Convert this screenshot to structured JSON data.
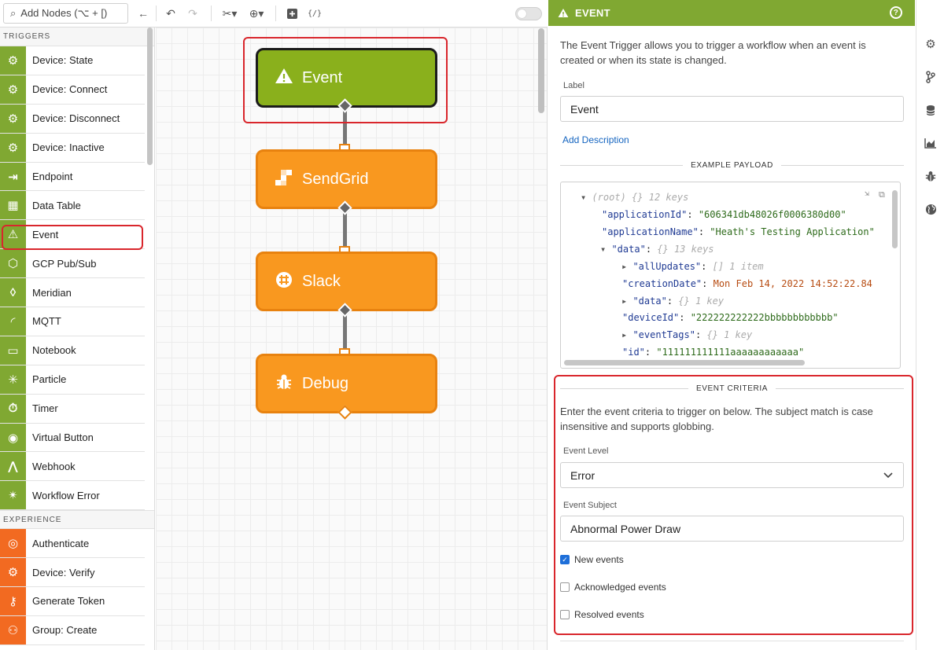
{
  "toolbar": {
    "search_placeholder": "Add Nodes (⌥ + [)",
    "icons": [
      "search-icon",
      "back-icon",
      "undo-icon",
      "redo-icon",
      "scissors-icon",
      "zoom-icon",
      "add-comment-icon",
      "variables-icon",
      "toggle-icon"
    ]
  },
  "sidebar": {
    "triggers_header": "TRIGGERS",
    "triggers": [
      {
        "label": "Device: State",
        "icon": "device-icon"
      },
      {
        "label": "Device: Connect",
        "icon": "device-icon"
      },
      {
        "label": "Device: Disconnect",
        "icon": "device-icon"
      },
      {
        "label": "Device: Inactive",
        "icon": "device-icon"
      },
      {
        "label": "Endpoint",
        "icon": "endpoint-icon"
      },
      {
        "label": "Data Table",
        "icon": "table-icon"
      },
      {
        "label": "Event",
        "icon": "warning-icon"
      },
      {
        "label": "GCP Pub/Sub",
        "icon": "gcp-icon"
      },
      {
        "label": "Meridian",
        "icon": "meridian-icon"
      },
      {
        "label": "MQTT",
        "icon": "mqtt-icon"
      },
      {
        "label": "Notebook",
        "icon": "notebook-icon"
      },
      {
        "label": "Particle",
        "icon": "particle-icon"
      },
      {
        "label": "Timer",
        "icon": "timer-icon"
      },
      {
        "label": "Virtual Button",
        "icon": "button-icon"
      },
      {
        "label": "Webhook",
        "icon": "webhook-icon"
      },
      {
        "label": "Workflow Error",
        "icon": "error-icon"
      }
    ],
    "experience_header": "EXPERIENCE",
    "experience": [
      {
        "label": "Authenticate",
        "icon": "fingerprint-icon"
      },
      {
        "label": "Device: Verify",
        "icon": "device-icon"
      },
      {
        "label": "Generate Token",
        "icon": "key-icon"
      },
      {
        "label": "Group: Create",
        "icon": "group-add-icon"
      }
    ]
  },
  "workflow": {
    "nodes": [
      {
        "label": "Event",
        "icon": "warning-icon",
        "selected": true
      },
      {
        "label": "SendGrid",
        "icon": "sendgrid-icon"
      },
      {
        "label": "Slack",
        "icon": "slack-icon"
      },
      {
        "label": "Debug",
        "icon": "bug-icon"
      }
    ]
  },
  "panel": {
    "title": "EVENT",
    "description": "The Event Trigger allows you to trigger a workflow when an event is created or when its state is changed.",
    "label_label": "Label",
    "label_value": "Event",
    "add_description": "Add Description",
    "payload_title": "EXAMPLE PAYLOAD",
    "payload": {
      "root": "(root)",
      "root_meta": "{}  12 keys",
      "applicationId_key": "\"applicationId\"",
      "applicationId_val": "\"606341db48026f0006380d00\"",
      "applicationName_key": "\"applicationName\"",
      "applicationName_val": "\"Heath's Testing Application\"",
      "data_key": "\"data\"",
      "data_meta": "{}  13 keys",
      "allUpdates_key": "\"allUpdates\"",
      "allUpdates_meta": "[]  1 item",
      "creationDate_key": "\"creationDate\"",
      "creationDate_val": "Mon Feb 14, 2022 14:52:22.84",
      "data2_key": "\"data\"",
      "data2_meta": "{}  1 key",
      "deviceId_key": "\"deviceId\"",
      "deviceId_val": "\"222222222222bbbbbbbbbbbb\"",
      "eventTags_key": "\"eventTags\"",
      "eventTags_meta": "{}  1 key",
      "id_key": "\"id\"",
      "id_val": "\"111111111111aaaaaaaaaaaa\""
    },
    "criteria_title": "EVENT CRITERIA",
    "criteria_description": "Enter the event criteria to trigger on below. The subject match is case insensitive and supports globbing.",
    "event_level_label": "Event Level",
    "event_level_value": "Error",
    "event_subject_label": "Event Subject",
    "event_subject_value": "Abnormal Power Draw",
    "checkboxes": [
      {
        "label": "New events",
        "checked": true
      },
      {
        "label": "Acknowledged events",
        "checked": false
      },
      {
        "label": "Resolved events",
        "checked": false
      }
    ]
  },
  "rail_icons": [
    "settings-icon",
    "branch-icon",
    "database-icon",
    "chart-icon",
    "bug-icon",
    "globe-icon"
  ],
  "colors": {
    "trigger_green": "#80a832",
    "node_orange": "#f9981f",
    "experience_orange": "#f26a21",
    "highlight_red": "#d9262c"
  }
}
